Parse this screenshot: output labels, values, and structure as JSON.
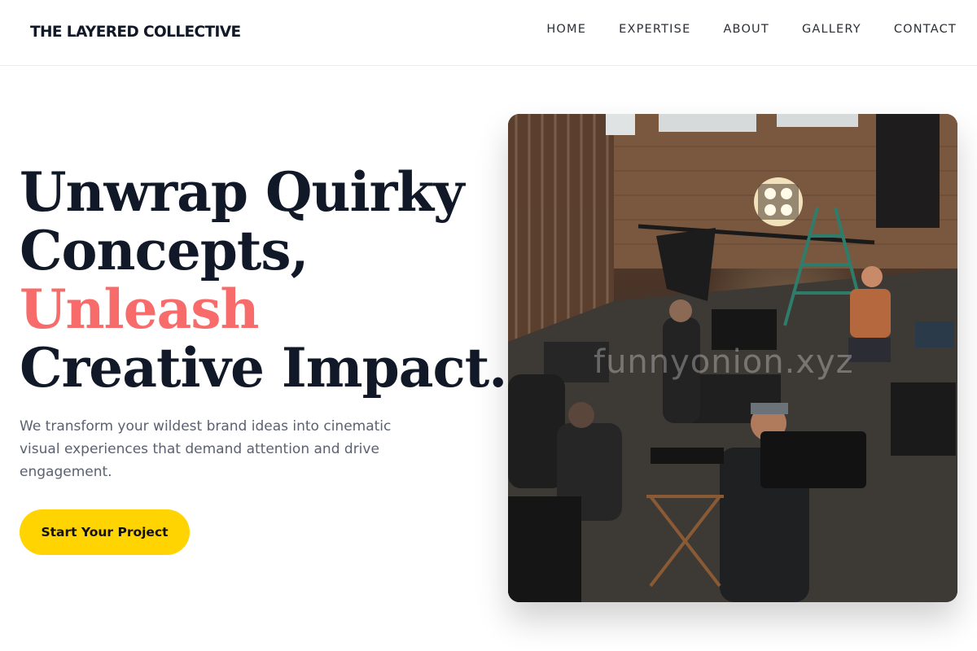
{
  "header": {
    "brand": "THE LAYERED COLLECTIVE",
    "nav": [
      "HOME",
      "EXPERTISE",
      "ABOUT",
      "GALLERY",
      "CONTACT"
    ]
  },
  "hero": {
    "title_line1": "Unwrap Quirky",
    "title_line2": "Concepts,",
    "title_accent": "Unleash",
    "title_line4": "Creative Impact.",
    "subtitle": "We transform your wildest brand ideas into cinematic visual experiences that demand attention and drive engagement.",
    "cta_label": "Start Your Project",
    "image_watermark": "funnyonion.xyz"
  },
  "colors": {
    "accent": "#f76b6b",
    "cta": "#ffd400",
    "text": "#111827"
  }
}
